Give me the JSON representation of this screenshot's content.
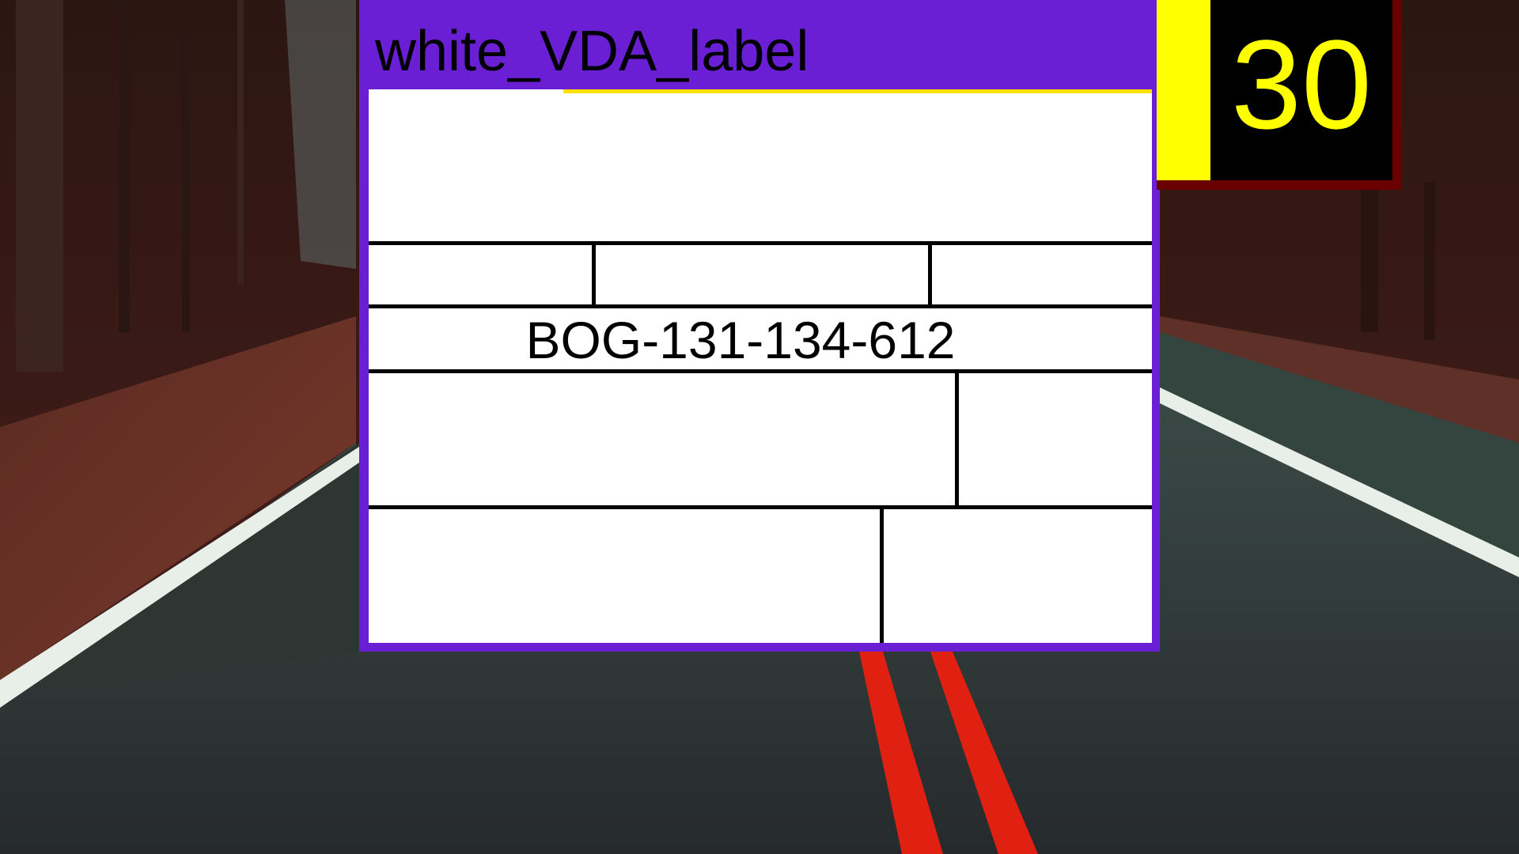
{
  "label": {
    "title": "white_VDA_label",
    "code": "BOG-131-134-612"
  },
  "speed": {
    "value": "30"
  },
  "colors": {
    "window_frame": "#6b1fd4",
    "label_background": "#ffffff",
    "badge_text": "#ffff00",
    "badge_panel": "#000000",
    "badge_border": "#6a0000",
    "road_marking_center": "#e02010",
    "road_marking_edge": "#e8eee8"
  }
}
